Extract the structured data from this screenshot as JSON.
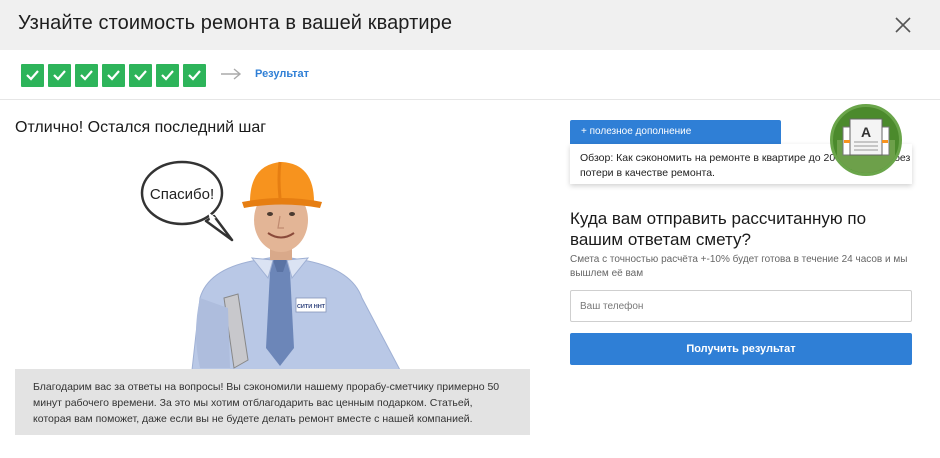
{
  "header": {
    "title": "Узнайте стоимость ремонта в вашей квартире",
    "close_icon": "close-icon"
  },
  "progress": {
    "completed_steps": 7,
    "check_color": "#2db45a",
    "result_label": "Результат"
  },
  "left": {
    "heading": "Отлично! Остался последний шаг",
    "speech_bubble": "Спасибо!",
    "thanks_text": "Благодарим вас за ответы на вопросы! Вы сэкономили нашему прорабу-сметчику примерно 50 минут рабочего времени. За это мы хотим отблагодарить вас ценным подарком. Статьей, которая вам поможет, даже если вы не будете делать ремонт вместе с нашей компанией."
  },
  "addon": {
    "tab_label": "+ полезное дополнение",
    "text": "Обзор: Как сэкономить на ремонте в квартире до 20% от сметы без потери в качестве ремонта.",
    "badge_icon": "book-icon",
    "badge_letter": "A"
  },
  "form": {
    "heading": "Куда вам отправить рассчитанную по вашим ответам смету?",
    "subtext": "Смета с точностью расчёта +-10% будет готова в течение 24 часов и мы вышлем её вам",
    "phone_placeholder": "Ваш телефон",
    "phone_value": "",
    "submit_label": "Получить результат"
  },
  "colors": {
    "accent": "#2f7fd6",
    "check_green": "#2db45a",
    "header_bg": "#f0f0f0",
    "hardhat": "#f7931e"
  }
}
